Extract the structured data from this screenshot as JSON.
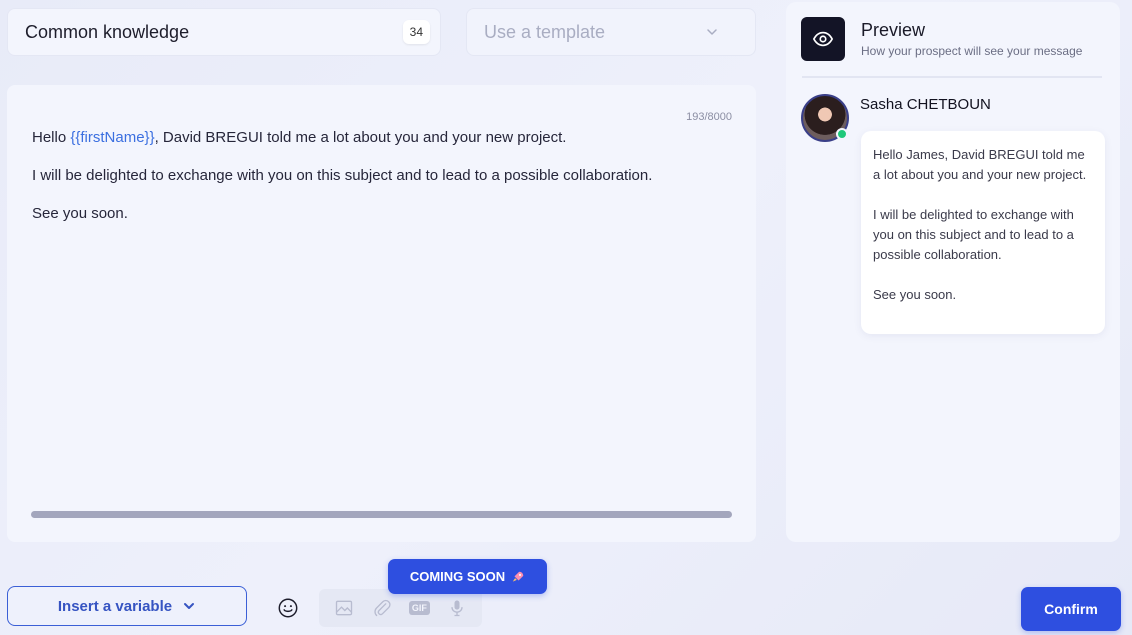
{
  "header": {
    "name_value": "Common knowledge",
    "name_count": "34",
    "template_placeholder": "Use a template"
  },
  "editor": {
    "char_count": "193/8000",
    "line1_prefix": "Hello ",
    "line1_variable": "{{firstName}}",
    "line1_suffix": ", David BREGUI told me a lot about you and your new project.",
    "line2": "I will be delighted to exchange with you on this subject and to lead to a possible collaboration.",
    "line3": "See you soon."
  },
  "preview": {
    "title": "Preview",
    "subtitle": "How your prospect will see your message",
    "sender_name": "Sasha CHETBOUN",
    "message_p1": "Hello James, David BREGUI told me a lot about you and your new project.",
    "message_p2": "I will be delighted to exchange with you on this subject and to lead to a possible collaboration.",
    "message_p3": "See you soon."
  },
  "toolbar": {
    "insert_variable_label": "Insert a variable",
    "coming_soon_label": "COMING SOON",
    "gif_label": "GIF",
    "confirm_label": "Confirm"
  },
  "colors": {
    "primary": "#2e4fe0",
    "variable": "#3b6fe0",
    "online": "#1fc87a",
    "preview_icon_bg": "#131426"
  },
  "icons": [
    "chevron-down-icon",
    "eye-icon",
    "smile-icon",
    "image-icon",
    "paperclip-icon",
    "gif-icon",
    "microphone-icon",
    "rocket-icon"
  ]
}
